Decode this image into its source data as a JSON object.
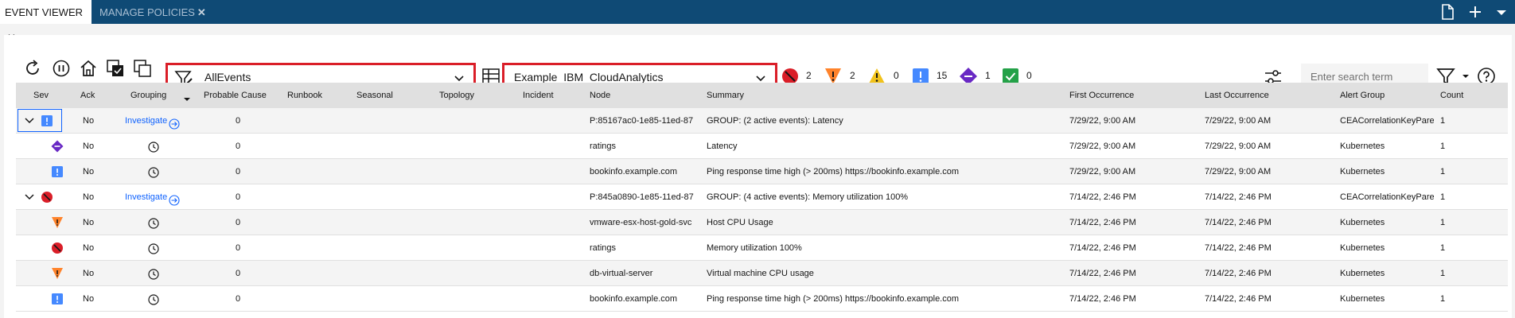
{
  "tabs": [
    {
      "label": "EVENT VIEWER",
      "active": true
    },
    {
      "label": "MANAGE POLICIES",
      "active": false
    }
  ],
  "toolbar": {
    "filter_value": "AllEvents",
    "view_value": "Example_IBM_CloudAnalytics",
    "search_placeholder": "Enter search term",
    "severity_counts": {
      "critical": "2",
      "major": "2",
      "minor": "0",
      "warning": "15",
      "indeterminate": "1",
      "clear": "0"
    }
  },
  "colors": {
    "topbar": "#0f4a75",
    "critical": "#da1e28",
    "major": "#ff832b",
    "minor": "#f1c21b",
    "info": "#4589ff",
    "indeterminate": "#6929c4",
    "clear": "#24a148",
    "link": "#0f62fe"
  },
  "table": {
    "columns": [
      "Sev",
      "Ack",
      "Grouping",
      "Probable Cause",
      "Runbook",
      "Seasonal",
      "Topology",
      "Incident",
      "Node",
      "Summary",
      "First Occurrence",
      "Last Occurrence",
      "Alert Group",
      "Count"
    ],
    "rows": [
      {
        "sev": "info",
        "group": true,
        "ack": "No",
        "grouping": "Investigate",
        "probable_cause": "0",
        "node": "P:85167ac0-1e85-11ed-87",
        "summary": "GROUP: (2 active events): Latency",
        "first": "7/29/22, 9:00 AM",
        "last": "7/29/22, 9:00 AM",
        "alert_group": "CEACorrelationKeyPare",
        "count": "1"
      },
      {
        "sev": "indeterminate",
        "group": false,
        "ack": "No",
        "grouping": "",
        "probable_cause": "0",
        "node": "ratings",
        "summary": "Latency",
        "first": "7/29/22, 9:00 AM",
        "last": "7/29/22, 9:00 AM",
        "alert_group": "Kubernetes",
        "count": "1"
      },
      {
        "sev": "info",
        "group": false,
        "ack": "No",
        "grouping": "",
        "probable_cause": "0",
        "node": "bookinfo.example.com",
        "summary": "Ping response time high (> 200ms) https://bookinfo.example.com",
        "first": "7/29/22, 9:00 AM",
        "last": "7/29/22, 9:00 AM",
        "alert_group": "Kubernetes",
        "count": "1"
      },
      {
        "sev": "critical",
        "group": true,
        "ack": "No",
        "grouping": "Investigate",
        "probable_cause": "0",
        "node": "P:845a0890-1e85-11ed-87",
        "summary": "GROUP: (4 active events): Memory utilization 100%",
        "first": "7/14/22, 2:46 PM",
        "last": "7/14/22, 2:46 PM",
        "alert_group": "CEACorrelationKeyPare",
        "count": "1"
      },
      {
        "sev": "major",
        "group": false,
        "ack": "No",
        "grouping": "",
        "probable_cause": "0",
        "node": "vmware-esx-host-gold-svc",
        "summary": "Host CPU Usage",
        "first": "7/14/22, 2:46 PM",
        "last": "7/14/22, 2:46 PM",
        "alert_group": "Kubernetes",
        "count": "1"
      },
      {
        "sev": "critical",
        "group": false,
        "ack": "No",
        "grouping": "",
        "probable_cause": "0",
        "node": "ratings",
        "summary": "Memory utilization 100%",
        "first": "7/14/22, 2:46 PM",
        "last": "7/14/22, 2:46 PM",
        "alert_group": "Kubernetes",
        "count": "1"
      },
      {
        "sev": "major",
        "group": false,
        "ack": "No",
        "grouping": "",
        "probable_cause": "0",
        "node": "db-virtual-server",
        "summary": "Virtual machine CPU usage",
        "first": "7/14/22, 2:46 PM",
        "last": "7/14/22, 2:46 PM",
        "alert_group": "Kubernetes",
        "count": "1"
      },
      {
        "sev": "info",
        "group": false,
        "ack": "No",
        "grouping": "",
        "probable_cause": "0",
        "node": "bookinfo.example.com",
        "summary": "Ping response time high (> 200ms) https://bookinfo.example.com",
        "first": "7/14/22, 2:46 PM",
        "last": "7/14/22, 2:46 PM",
        "alert_group": "Kubernetes",
        "count": "1"
      }
    ]
  }
}
